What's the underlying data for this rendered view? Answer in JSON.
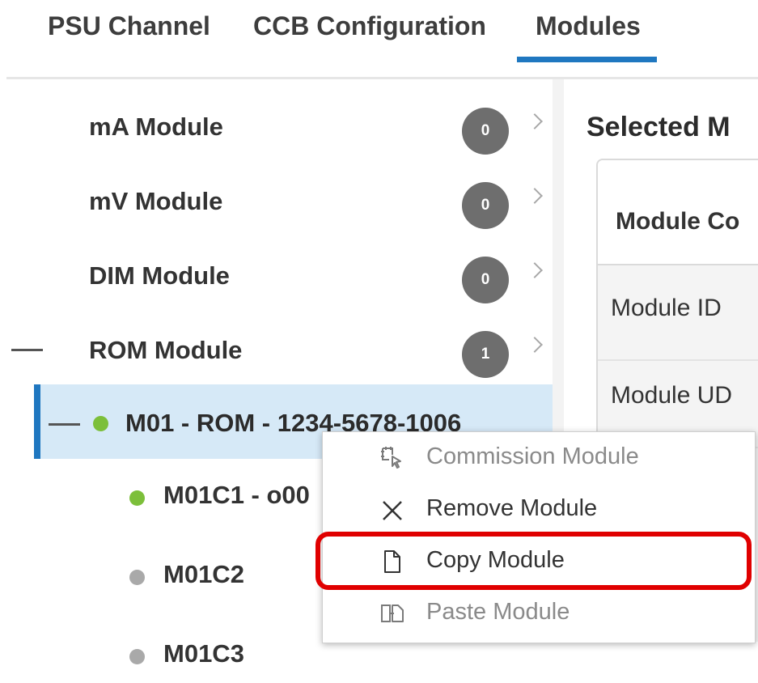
{
  "tabs": [
    {
      "label": "PSU Channel",
      "active": false
    },
    {
      "label": "CCB Configuration",
      "active": false
    },
    {
      "label": "Modules",
      "active": true
    }
  ],
  "colors": {
    "accent": "#1f77c0",
    "selected_row_bg": "#d6e9f7",
    "status_online": "#7cbf3a",
    "status_offline": "#a9a9a9",
    "badge_bg": "#6e6e6e",
    "highlight_border": "#e00000"
  },
  "modules": [
    {
      "label": "mA Module",
      "count": "0",
      "expanded": false
    },
    {
      "label": "mV Module",
      "count": "0",
      "expanded": false
    },
    {
      "label": "DIM Module",
      "count": "0",
      "expanded": false
    },
    {
      "label": "ROM Module",
      "count": "1",
      "expanded": true
    }
  ],
  "selected_module": {
    "label": "M01 - ROM - 1234-5678-1006",
    "status": "online"
  },
  "channels": [
    {
      "label": "M01C1 - o00",
      "status": "online"
    },
    {
      "label": "M01C2",
      "status": "offline"
    },
    {
      "label": "M01C3",
      "status": "offline"
    }
  ],
  "details": {
    "title": "Selected M",
    "table_header": "Module Co",
    "fields": [
      "Module ID",
      "Module UD"
    ]
  },
  "context_menu": {
    "items": [
      {
        "label": "Commission Module",
        "icon": "commission-icon",
        "enabled": false
      },
      {
        "label": "Remove Module",
        "icon": "close-icon",
        "enabled": true
      },
      {
        "label": "Copy Module",
        "icon": "document-icon",
        "enabled": true,
        "highlighted": true
      },
      {
        "label": "Paste Module",
        "icon": "paste-icon",
        "enabled": false
      }
    ]
  }
}
